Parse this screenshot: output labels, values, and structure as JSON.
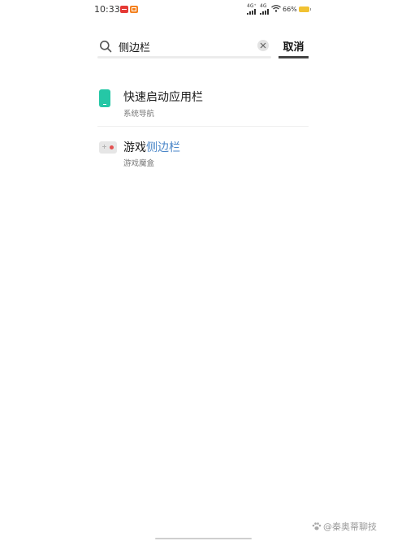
{
  "status_bar": {
    "time": "10:33",
    "signal1_label": "4G⁺",
    "signal2_label": "4G",
    "battery_text": "66%",
    "battery_color": "#f1c232"
  },
  "search": {
    "query": "侧边栏",
    "cancel_label": "取消"
  },
  "results": [
    {
      "title_pre": "快速启动应用栏",
      "title_hl": "",
      "subtitle": "系统导航",
      "icon": "phone-app-icon"
    },
    {
      "title_pre": "游戏",
      "title_hl": "侧边栏",
      "subtitle": "游戏魔盒",
      "icon": "gamepad-icon"
    }
  ],
  "highlight_color": "#4a86c8",
  "watermark": "@秦奥蒂聊技"
}
